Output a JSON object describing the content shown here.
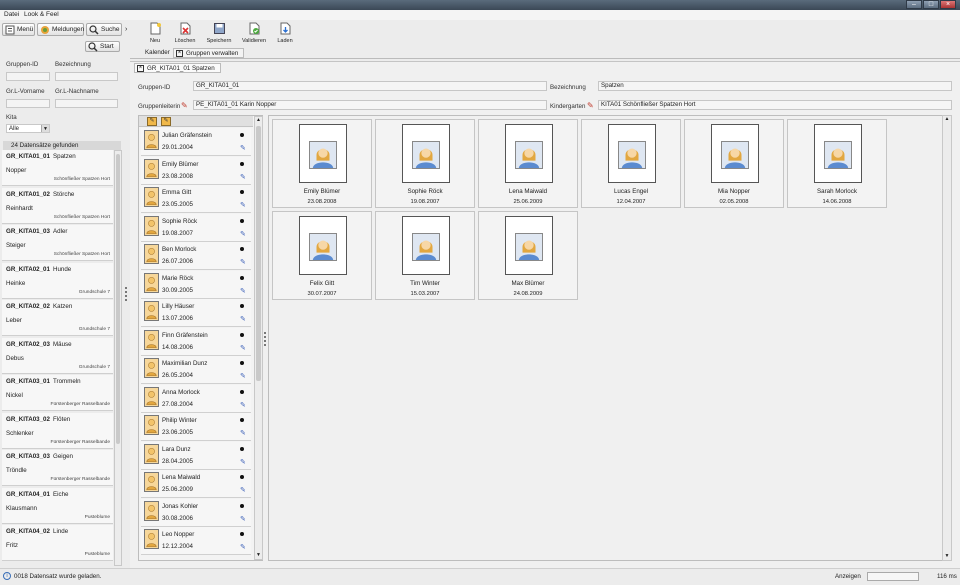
{
  "menubar": {
    "items": [
      "Datei",
      "Look & Feel"
    ]
  },
  "nav": {
    "menu": "Menü",
    "meldungen": "Meldungen",
    "suche": "Suche"
  },
  "search": {
    "start": "Start",
    "fields": {
      "gruppen_id": "Gruppen-ID",
      "bezeichnung": "Bezeichnung",
      "vorname": "Gr.L-Vorname",
      "nachname": "Gr.L-Nachname",
      "kita": "Kita"
    },
    "kita_value": "Alle",
    "result_count": "24 Datensätze gefunden"
  },
  "groups": [
    {
      "id": "GR_KITA01_01",
      "name": "Spatzen",
      "leader": "Nopper",
      "kita": "Schönfließer Spatzen Hort"
    },
    {
      "id": "GR_KITA01_02",
      "name": "Störche",
      "leader": "Reinhardt",
      "kita": "Schönfließer Spatzen Hort"
    },
    {
      "id": "GR_KITA01_03",
      "name": "Adler",
      "leader": "Steiger",
      "kita": "Schönfließer Spatzen Hort"
    },
    {
      "id": "GR_KITA02_01",
      "name": "Hunde",
      "leader": "Heinke",
      "kita": "Grundschule 7"
    },
    {
      "id": "GR_KITA02_02",
      "name": "Katzen",
      "leader": "Leber",
      "kita": "Grundschule 7"
    },
    {
      "id": "GR_KITA02_03",
      "name": "Mäuse",
      "leader": "Debus",
      "kita": "Grundschule 7"
    },
    {
      "id": "GR_KITA03_01",
      "name": "Trommeln",
      "leader": "Nickel",
      "kita": "Fürstenberger Rasselbande"
    },
    {
      "id": "GR_KITA03_02",
      "name": "Flöten",
      "leader": "Schlenker",
      "kita": "Fürstenberger Rasselbande"
    },
    {
      "id": "GR_KITA03_03",
      "name": "Geigen",
      "leader": "Tröndle",
      "kita": "Fürstenberger Rasselbande"
    },
    {
      "id": "GR_KITA04_01",
      "name": "Eiche",
      "leader": "Klausmann",
      "kita": "Pusteblume"
    },
    {
      "id": "GR_KITA04_02",
      "name": "Linde",
      "leader": "Fritz",
      "kita": "Pusteblume"
    }
  ],
  "toolbar": {
    "neu": "Neu",
    "loeschen": "Löschen",
    "speichern": "Speichern",
    "validieren": "Validieren",
    "laden": "Laden"
  },
  "tabs": {
    "kalender": "Kalender",
    "gruppen": "Gruppen verwalten",
    "doc": "GR_KITA01_01 Spatzen"
  },
  "detail": {
    "gruppen_id_label": "Gruppen-ID",
    "gruppen_id": "GR_KITA01_01",
    "bezeichnung_label": "Bezeichnung",
    "bezeichnung": "Spatzen",
    "leiterin_label": "Gruppenleiterin",
    "leiterin": "PE_KITA01_01 Karin Nopper",
    "kindergarten_label": "Kindergarten",
    "kindergarten": "KITA01 Schönfließer Spatzen Hort"
  },
  "children": [
    {
      "name": "Julian Gräfenstein",
      "date": "29.01.2004"
    },
    {
      "name": "Emily Blümer",
      "date": "23.08.2008"
    },
    {
      "name": "Emma Gitt",
      "date": "23.05.2005"
    },
    {
      "name": "Sophie Röck",
      "date": "19.08.2007"
    },
    {
      "name": "Ben Morlock",
      "date": "26.07.2006"
    },
    {
      "name": "Marie Röck",
      "date": "30.09.2005"
    },
    {
      "name": "Lilly Häuser",
      "date": "13.07.2006"
    },
    {
      "name": "Finn Gräfenstein",
      "date": "14.08.2006"
    },
    {
      "name": "Maximilian Dunz",
      "date": "26.05.2004"
    },
    {
      "name": "Anna Morlock",
      "date": "27.08.2004"
    },
    {
      "name": "Philip Winter",
      "date": "23.06.2005"
    },
    {
      "name": "Lara Dunz",
      "date": "28.04.2005"
    },
    {
      "name": "Lena Maiwald",
      "date": "25.06.2009"
    },
    {
      "name": "Jonas Kohler",
      "date": "30.08.2006"
    },
    {
      "name": "Leo Nopper",
      "date": "12.12.2004"
    }
  ],
  "members": [
    {
      "name": "Emily Blümer",
      "date": "23.08.2008"
    },
    {
      "name": "Sophie Röck",
      "date": "19.08.2007"
    },
    {
      "name": "Lena Maiwald",
      "date": "25.06.2009"
    },
    {
      "name": "Lucas Engel",
      "date": "12.04.2007"
    },
    {
      "name": "Mia Nopper",
      "date": "02.05.2008"
    },
    {
      "name": "Sarah Morlock",
      "date": "14.06.2008"
    },
    {
      "name": "Felix Gitt",
      "date": "30.07.2007"
    },
    {
      "name": "Tim Winter",
      "date": "15.03.2007"
    },
    {
      "name": "Max Blümer",
      "date": "24.08.2009"
    }
  ],
  "status": {
    "message": "0018 Datensatz wurde geladen.",
    "anzeigen": "Anzeigen",
    "time": "116 ms"
  },
  "colors": {
    "avatar_bg": "#f7d79a",
    "pen": "#3a5fb8",
    "delete": "#d33"
  }
}
